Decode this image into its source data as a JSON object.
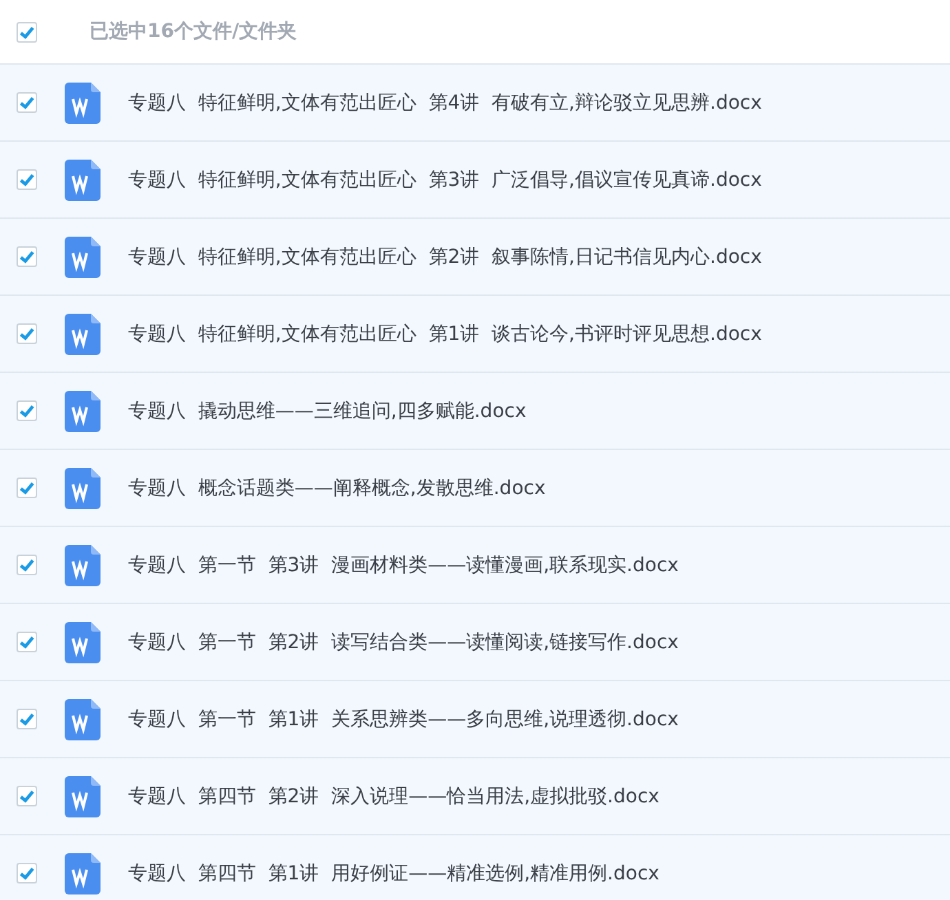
{
  "header": {
    "checked": true,
    "label": "已选中16个文件/文件夹"
  },
  "files": [
    {
      "checked": true,
      "name": "专题八  特征鲜明,文体有范出匠心  第4讲  有破有立,辩论驳立见思辨.docx"
    },
    {
      "checked": true,
      "name": "专题八  特征鲜明,文体有范出匠心  第3讲  广泛倡导,倡议宣传见真谛.docx"
    },
    {
      "checked": true,
      "name": "专题八  特征鲜明,文体有范出匠心  第2讲  叙事陈情,日记书信见内心.docx"
    },
    {
      "checked": true,
      "name": "专题八  特征鲜明,文体有范出匠心  第1讲  谈古论今,书评时评见思想.docx"
    },
    {
      "checked": true,
      "name": "专题八  撬动思维——三维追问,四多赋能.docx"
    },
    {
      "checked": true,
      "name": "专题八  概念话题类——阐释概念,发散思维.docx"
    },
    {
      "checked": true,
      "name": "专题八  第一节  第3讲  漫画材料类——读懂漫画,联系现实.docx"
    },
    {
      "checked": true,
      "name": "专题八  第一节  第2讲  读写结合类——读懂阅读,链接写作.docx"
    },
    {
      "checked": true,
      "name": "专题八  第一节  第1讲  关系思辨类——多向思维,说理透彻.docx"
    },
    {
      "checked": true,
      "name": "专题八  第四节  第2讲  深入说理——恰当用法,虚拟批驳.docx"
    },
    {
      "checked": true,
      "name": "专题八  第四节  第1讲  用好例证——精准选例,精准用例.docx"
    }
  ]
}
